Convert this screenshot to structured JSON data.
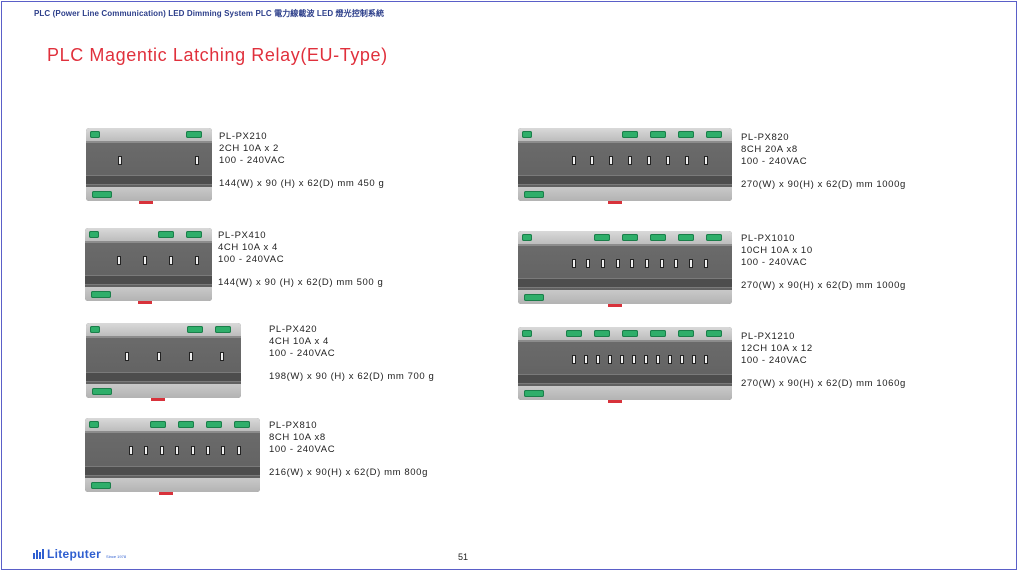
{
  "header": {
    "line": "PLC (Power Line Communication)   LED Dimming System   PLC 電力線載波 LED 燈光控制系統"
  },
  "page_title": "PLC Magentic Latching Relay(EU-Type)",
  "products": [
    {
      "model": "PL-PX210",
      "channels": "2CH  10A x 2",
      "voltage": "100 - 240VAC",
      "size": "144(W)  x 90 (H) x 62(D) mm  450 g"
    },
    {
      "model": "PL-PX410",
      "channels": "4CH  10A x 4",
      "voltage": "100 - 240VAC",
      "size": "144(W)  x 90 (H) x 62(D) mm  500 g"
    },
    {
      "model": "PL-PX420",
      "channels": "4CH  10A x 4",
      "voltage": "100 - 240VAC",
      "size": "198(W)  x 90 (H) x 62(D) mm  700 g"
    },
    {
      "model": "PL-PX810",
      "channels": "8CH  10A x8",
      "voltage": "100 - 240VAC",
      "size": "216(W) x 90(H) x 62(D) mm 800g"
    },
    {
      "model": "PL-PX820",
      "channels": "8CH  20A x8",
      "voltage": "100 - 240VAC",
      "size": "270(W) x 90(H) x 62(D) mm 1000g"
    },
    {
      "model": "PL-PX1010",
      "channels": "10CH  10A x 10",
      "voltage": "100 - 240VAC",
      "size": "270(W) x 90(H) x 62(D) mm 1000g"
    },
    {
      "model": "PL-PX1210",
      "channels": "12CH  10A x 12",
      "voltage": "100 - 240VAC",
      "size": "270(W) x 90(H) x 62(D) mm 1060g"
    }
  ],
  "footer": {
    "page_number": "51",
    "logo_text": "Liteputer",
    "logo_since": "Since 1978"
  },
  "colors": {
    "title": "#e0303c",
    "header": "#2c3e8a",
    "brand": "#2f5fd0",
    "terminal": "#2fae6a",
    "frame": "#5a5fc8"
  }
}
